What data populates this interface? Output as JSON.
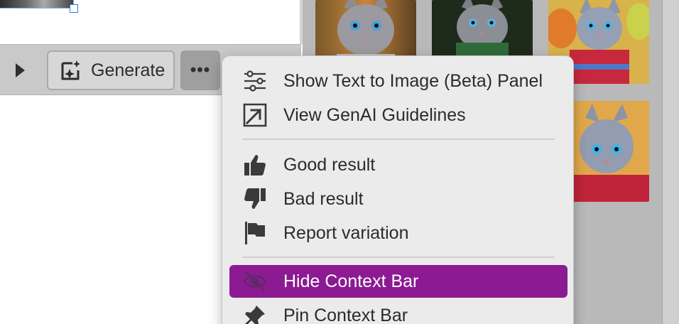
{
  "context_bar": {
    "generate_label": "Generate",
    "more_label": "•••"
  },
  "menu": {
    "items": [
      {
        "label": "Show Text to Image (Beta) Panel",
        "icon": "sliders-icon"
      },
      {
        "label": "View GenAI Guidelines",
        "icon": "external-link-icon"
      },
      {
        "label": "Good result",
        "icon": "thumbs-up-icon"
      },
      {
        "label": "Bad result",
        "icon": "thumbs-down-icon"
      },
      {
        "label": "Report variation",
        "icon": "flag-icon"
      },
      {
        "label": "Hide Context Bar",
        "icon": "eye-off-icon",
        "selected": true
      },
      {
        "label": "Pin Context Bar",
        "icon": "pin-icon"
      }
    ]
  },
  "colors": {
    "selected_item": "#8b1a93",
    "menu_background": "#ebebeb",
    "context_bar": "#c9c9c9",
    "panel_background": "#b9b9b9"
  }
}
